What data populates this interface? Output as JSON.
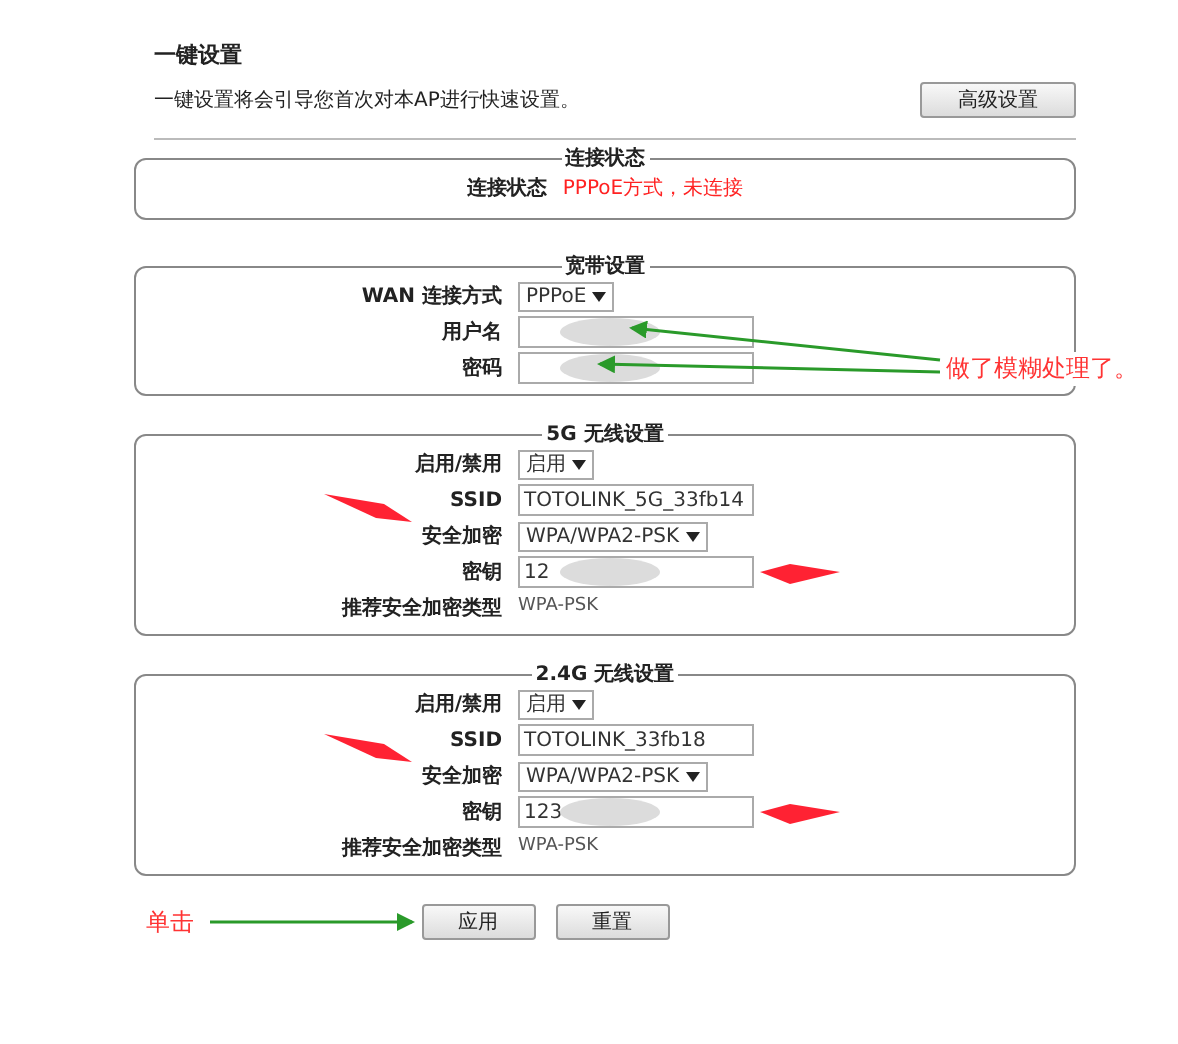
{
  "page": {
    "title": "一键设置",
    "description": "一键设置将会引导您首次对本AP进行快速设置。",
    "advanced_button": "高级设置"
  },
  "sections": [
    {
      "legend": "连接状态",
      "rows": [
        {
          "kind": "status",
          "label": "连接状态",
          "value": "PPPoE方式，未连接"
        }
      ]
    },
    {
      "legend": "宽带设置",
      "rows": [
        {
          "kind": "select",
          "label": "WAN 连接方式",
          "value": "PPPoE"
        },
        {
          "kind": "input",
          "label": "用户名",
          "blurred": true
        },
        {
          "kind": "input",
          "label": "密码",
          "blurred": true
        }
      ]
    },
    {
      "legend": "5G 无线设置",
      "rows": [
        {
          "kind": "select",
          "label": "启用/禁用",
          "value": "启用"
        },
        {
          "kind": "input",
          "label": "SSID",
          "value": "TOTOLINK_5G_33fb14",
          "blurred": false
        },
        {
          "kind": "select",
          "label": "安全加密",
          "value": "WPA/WPA2-PSK"
        },
        {
          "kind": "input",
          "label": "密钥",
          "value": "12",
          "blurred": true
        },
        {
          "kind": "text",
          "label": "推荐安全加密类型",
          "value": "WPA-PSK"
        }
      ]
    },
    {
      "legend": "2.4G 无线设置",
      "rows": [
        {
          "kind": "select",
          "label": "启用/禁用",
          "value": "启用"
        },
        {
          "kind": "input",
          "label": "SSID",
          "value": "TOTOLINK_33fb18",
          "blurred": false
        },
        {
          "kind": "select",
          "label": "安全加密",
          "value": "WPA/WPA2-PSK"
        },
        {
          "kind": "input",
          "label": "密钥",
          "value": "123",
          "blurred": true
        },
        {
          "kind": "text",
          "label": "推荐安全加密类型",
          "value": "WPA-PSK"
        }
      ]
    }
  ],
  "buttons": [
    "应用",
    "重置"
  ],
  "annotations": [
    {
      "kind": "blur-note",
      "text": "做了模糊处理了。"
    },
    {
      "kind": "click-note",
      "text": "单击"
    }
  ]
}
